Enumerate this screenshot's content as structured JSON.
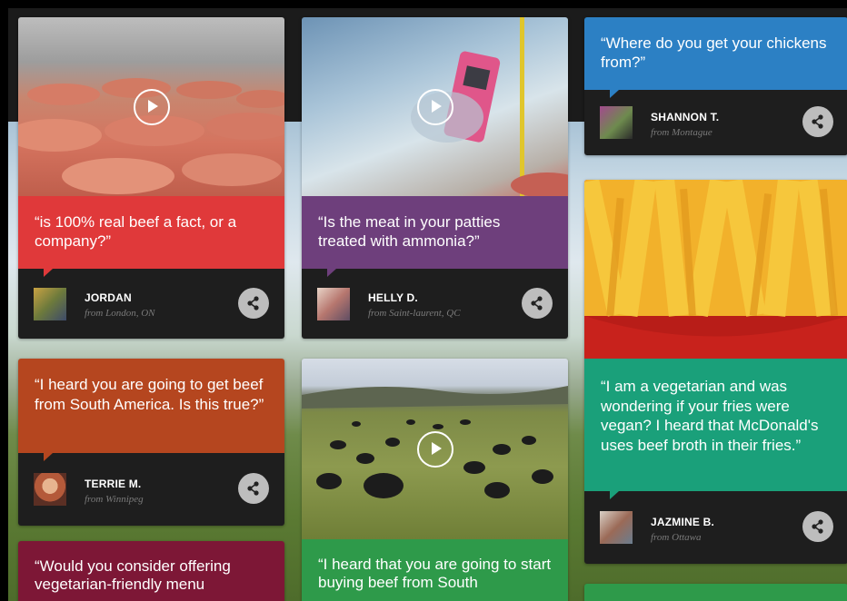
{
  "cards": [
    {
      "question": "“is 100% real beef a fact, or a company?”",
      "name": "JORDAN",
      "from": "from London, ON",
      "color": "#e0393a"
    },
    {
      "question": "“Is the meat in your patties treated with ammonia?”",
      "name": "HELLY D.",
      "from": "from Saint-laurent, QC",
      "color": "#6e3f7c"
    },
    {
      "question": "“Where do you get your chickens from?”",
      "name": "SHANNON T.",
      "from": "from Montague",
      "color": "#2c80c4"
    },
    {
      "question": "“I heard you are going to get beef from South America. Is this true?”",
      "name": "TERRIE M.",
      "from": "from Winnipeg",
      "color": "#b5461f"
    },
    {
      "question": "“I am a vegetarian and was wondering if your fries were vegan? I heard that McDonald's uses beef broth in their fries.”",
      "name": "JAZMINE B.",
      "from": "from Ottawa",
      "color": "#1aa07a"
    },
    {
      "question": "“Would you consider offering vegetarian-friendly menu",
      "color": "#7d1736"
    },
    {
      "question": "“I heard that you are going to start buying beef from South",
      "color": "#2e9a4a"
    }
  ],
  "icons": {
    "play": "play-icon",
    "share": "share-icon"
  }
}
